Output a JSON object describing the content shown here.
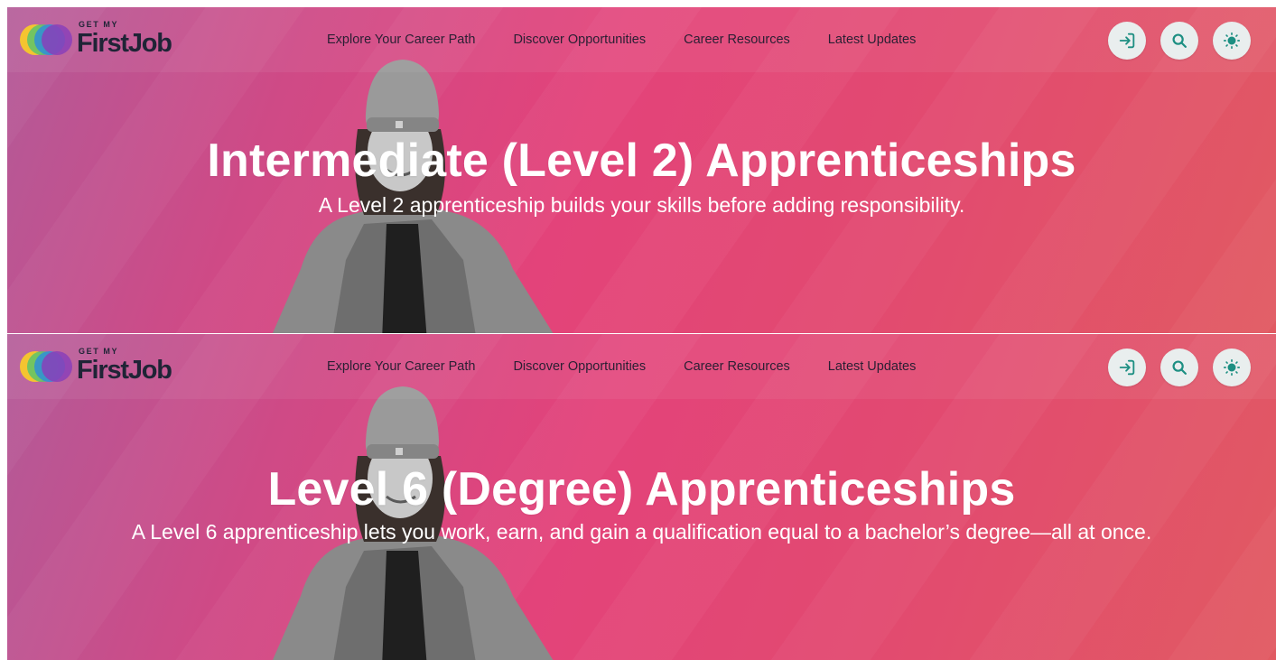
{
  "colors": {
    "brand_dark": "#1f2436",
    "icon_teal": "#1d8f82",
    "button_bg": "#e9eeee",
    "hero_pink": "#e3437a"
  },
  "logo": {
    "small": "GET MY",
    "main": "FirstJob"
  },
  "nav": {
    "links": [
      "Explore Your Career Path",
      "Discover Opportunities",
      "Career Resources",
      "Latest Updates"
    ]
  },
  "icons": {
    "login": "login-arrow-icon",
    "search": "search-icon",
    "theme": "sun-icon"
  },
  "panels": [
    {
      "title": "Intermediate (Level 2) Apprenticeships",
      "subtitle": "A Level 2 apprenticeship builds your skills before adding responsibility."
    },
    {
      "title": "Level 6 (Degree) Apprenticeships",
      "subtitle": "A Level 6 apprenticeship lets you work, earn, and gain a qualification equal to a bachelor’s degree—all at once."
    }
  ]
}
